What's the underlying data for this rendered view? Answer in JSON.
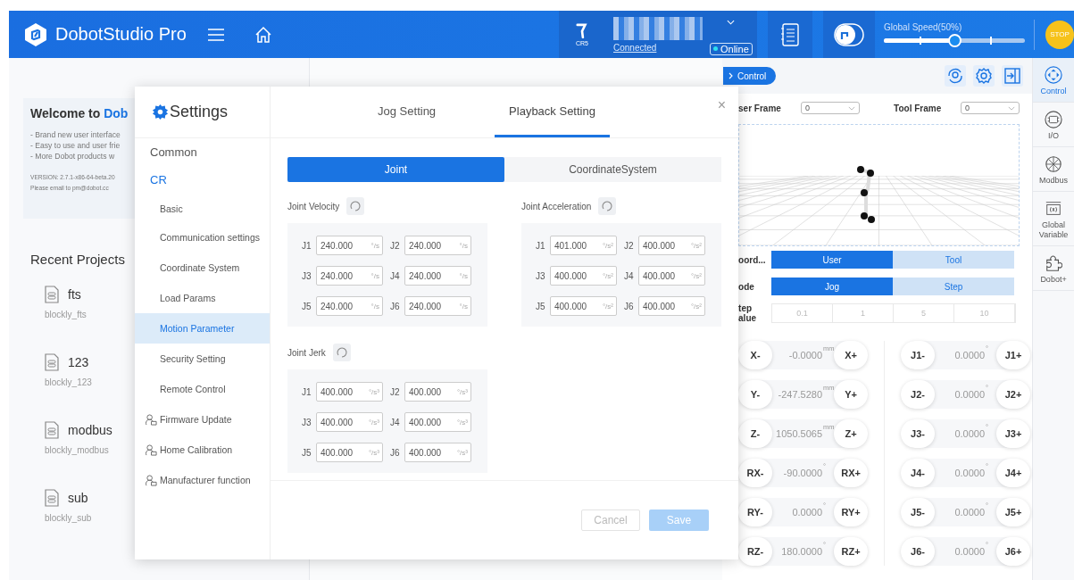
{
  "header": {
    "app_name": "DobotStudio Pro",
    "robot_model": "CR5",
    "connection": "Connected",
    "status": "Online",
    "speed_label": "Global Speed(50%)",
    "speed": {
      "level": 0.5
    },
    "stop": "STOP"
  },
  "home": {
    "welcome_title": "Welcome to",
    "welcome_brand": "Dob",
    "features": [
      "- Brand new user interface",
      "- Easy to use and user frie",
      "- More Dobot products w"
    ],
    "version": "VERSION: 2.7.1-x86-64-beta.20",
    "email": "Please email to pm@dobot.cc",
    "recent_title": "Recent Projects",
    "projects": [
      {
        "name": "fts",
        "file": "blockly_fts"
      },
      {
        "name": "123",
        "file": "blockly_123"
      },
      {
        "name": "modbus",
        "file": "blockly_modbus"
      },
      {
        "name": "sub",
        "file": "blockly_sub"
      }
    ]
  },
  "settings": {
    "title": "Settings",
    "nav": [
      {
        "label": "Common",
        "kind": "group",
        "selected": false
      },
      {
        "label": "CR",
        "kind": "group",
        "selected": true
      },
      {
        "label": "Basic",
        "kind": "page",
        "selected": false
      },
      {
        "label": "Communication settings",
        "kind": "page",
        "selected": false
      },
      {
        "label": "Coordinate System",
        "kind": "page",
        "selected": false
      },
      {
        "label": "Load Params",
        "kind": "page",
        "selected": false
      },
      {
        "label": "Motion Parameter",
        "kind": "page",
        "selected": true
      },
      {
        "label": "Security Setting",
        "kind": "page",
        "selected": false
      },
      {
        "label": "Remote Control",
        "kind": "page",
        "selected": false
      },
      {
        "label": "Firmware Update",
        "kind": "account",
        "selected": false
      },
      {
        "label": "Home Calibration",
        "kind": "account",
        "selected": false
      },
      {
        "label": "Manufacturer function",
        "kind": "account",
        "selected": false
      }
    ],
    "tabs": [
      {
        "label": "Jog Setting",
        "selected": false
      },
      {
        "label": "Playback Setting",
        "selected": true
      }
    ],
    "close": "×",
    "segments": [
      {
        "label": "Joint",
        "selected": true
      },
      {
        "label": "CoordinateSystem",
        "selected": false
      }
    ],
    "sections": [
      {
        "title": "Joint Velocity",
        "fields": [
          {
            "label": "J1",
            "value": "240.000",
            "unit": "°/s"
          },
          {
            "label": "J2",
            "value": "240.000",
            "unit": "°/s"
          },
          {
            "label": "J3",
            "value": "240.000",
            "unit": "°/s"
          },
          {
            "label": "J4",
            "value": "240.000",
            "unit": "°/s"
          },
          {
            "label": "J5",
            "value": "240.000",
            "unit": "°/s"
          },
          {
            "label": "J6",
            "value": "240.000",
            "unit": "°/s"
          }
        ]
      },
      {
        "title": "Joint Acceleration",
        "fields": [
          {
            "label": "J1",
            "value": "401.000",
            "unit": "°/s²"
          },
          {
            "label": "J2",
            "value": "400.000",
            "unit": "°/s²"
          },
          {
            "label": "J3",
            "value": "400.000",
            "unit": "°/s²"
          },
          {
            "label": "J4",
            "value": "400.000",
            "unit": "°/s²"
          },
          {
            "label": "J5",
            "value": "400.000",
            "unit": "°/s²"
          },
          {
            "label": "J6",
            "value": "400.000",
            "unit": "°/s²"
          }
        ]
      },
      {
        "title": "Joint Jerk",
        "fields": [
          {
            "label": "J1",
            "value": "400.000",
            "unit": "°/s³"
          },
          {
            "label": "J2",
            "value": "400.000",
            "unit": "°/s³"
          },
          {
            "label": "J3",
            "value": "400.000",
            "unit": "°/s³"
          },
          {
            "label": "J4",
            "value": "400.000",
            "unit": "°/s³"
          },
          {
            "label": "J5",
            "value": "400.000",
            "unit": "°/s³"
          },
          {
            "label": "J6",
            "value": "400.000",
            "unit": "°/s³"
          }
        ]
      }
    ],
    "cancel": {
      "label": "Cancel",
      "disabled": true
    },
    "save": {
      "label": "Save",
      "disabled": true
    }
  },
  "control": {
    "tab": "Control",
    "user_frame_label": "ser Frame",
    "user_frame": "0",
    "tool_frame_label": "Tool Frame",
    "tool_frame": "0",
    "coord_label": "oord...",
    "coord_options": [
      {
        "label": "User",
        "selected": true
      },
      {
        "label": "Tool",
        "selected": false
      }
    ],
    "mode_label": "ode",
    "modes": [
      {
        "label": "Jog",
        "selected": true
      },
      {
        "label": "Step",
        "selected": false
      }
    ],
    "step_label": "tep alue",
    "step_disabled": true,
    "step_values": [
      "0.1",
      "1",
      "5",
      "10"
    ],
    "cartesian": [
      {
        "minus": "X-",
        "value": "-0.0000",
        "unit": "mm",
        "plus": "X+"
      },
      {
        "minus": "Y-",
        "value": "-247.5280",
        "unit": "mm",
        "plus": "Y+"
      },
      {
        "minus": "Z-",
        "value": "1050.5065",
        "unit": "mm",
        "plus": "Z+"
      },
      {
        "minus": "RX-",
        "value": "-90.0000",
        "unit": "°",
        "plus": "RX+"
      },
      {
        "minus": "RY-",
        "value": "0.0000",
        "unit": "°",
        "plus": "RY+"
      },
      {
        "minus": "RZ-",
        "value": "180.0000",
        "unit": "°",
        "plus": "RZ+"
      }
    ],
    "joints": [
      {
        "minus": "J1-",
        "value": "0.0000",
        "unit": "°",
        "plus": "J1+"
      },
      {
        "minus": "J2-",
        "value": "0.0000",
        "unit": "°",
        "plus": "J2+"
      },
      {
        "minus": "J3-",
        "value": "0.0000",
        "unit": "°",
        "plus": "J3+"
      },
      {
        "minus": "J4-",
        "value": "0.0000",
        "unit": "°",
        "plus": "J4+"
      },
      {
        "minus": "J5-",
        "value": "0.0000",
        "unit": "°",
        "plus": "J5+"
      },
      {
        "minus": "J6-",
        "value": "0.0000",
        "unit": "°",
        "plus": "J6+"
      }
    ]
  },
  "sidebar": [
    {
      "label": "Control",
      "kind": "control",
      "selected": true
    },
    {
      "label": "I/O",
      "kind": "io",
      "selected": false
    },
    {
      "label": "Modbus",
      "kind": "modbus",
      "selected": false
    },
    {
      "label": "Global Variable",
      "kind": "variable",
      "selected": false
    },
    {
      "label": "Dobot+",
      "kind": "plugin",
      "selected": false
    }
  ]
}
